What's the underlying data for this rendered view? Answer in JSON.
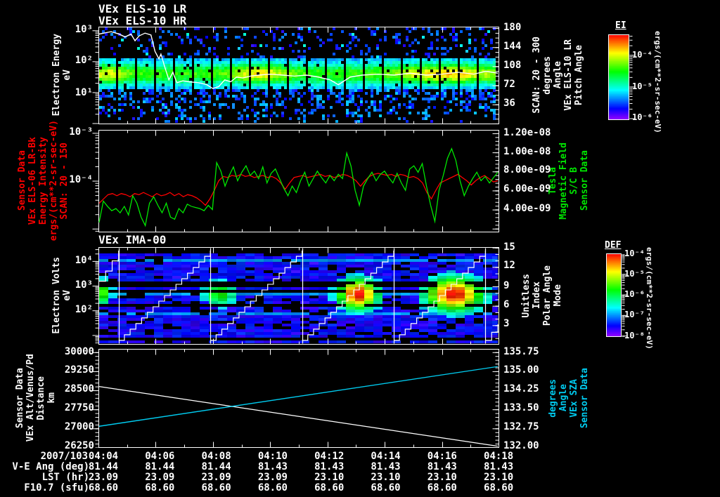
{
  "colors": {
    "background": "#000000",
    "foreground": "#ffffff",
    "red": "#ff0000",
    "green": "#00e600",
    "cyan": "#00ccf0"
  },
  "titles": {
    "els_lr": "VEx ELS-10 LR",
    "els_hr": "VEx ELS-10 HR",
    "ima": "VEx IMA-00"
  },
  "panel1": {
    "ylabel_lines": [
      "Electron Energy",
      "eV"
    ],
    "left_ticks": [
      "10³",
      "10²",
      "10¹"
    ],
    "right_ticks": [
      "180",
      "144",
      "108",
      "72",
      "36"
    ],
    "right_label_lines": [
      "Pitch Angle",
      "VEx ELS-10 LR",
      "Angle",
      "degrees",
      "SCAN: 20 - 300"
    ],
    "colorbar": {
      "title": "EI",
      "ticks": [
        "10⁻⁴",
        "10⁻⁵",
        "10⁻⁶"
      ],
      "unit": "ergs/(cm**2-sr-sec-eV)"
    }
  },
  "panel2": {
    "left_label_lines": [
      "Sensor Data",
      "VEx ELS-06 LR-Bk",
      "Energy Intensity",
      "ergs/(cm**2-sr-sec-eV)",
      "SCAN: 20 - 150"
    ],
    "left_ticks": [
      "10⁻³",
      "10⁻⁴"
    ],
    "right_ticks": [
      "1.20e-08",
      "1.00e-08",
      "8.00e-09",
      "6.00e-09",
      "4.00e-09"
    ],
    "right_label_lines": [
      "Sensor Data",
      "S/C B",
      "Magnetic Field",
      "Tesla"
    ]
  },
  "panel3": {
    "ylabel_lines": [
      "Electron Volts",
      "eV"
    ],
    "left_ticks": [
      "10⁴",
      "10³",
      "10²"
    ],
    "right_ticks": [
      "15",
      "12",
      "9",
      "6",
      "3"
    ],
    "right_label_lines": [
      "Mode",
      "Polar Angle",
      "Index",
      "Unitless"
    ],
    "colorbar": {
      "title": "DEF",
      "ticks": [
        "10⁻⁴",
        "10⁻⁵",
        "10⁻⁶",
        "10⁻⁷",
        "10⁻⁸"
      ],
      "unit": "ergs/(cm**2-sr-sec-eV)"
    }
  },
  "panel4": {
    "left_label_lines": [
      "Sensor Data",
      "VEx Alt/Venus/Pd",
      "Distance",
      "km"
    ],
    "left_ticks": [
      "30000",
      "29250",
      "28500",
      "27750",
      "27000",
      "26250"
    ],
    "right_ticks": [
      "135.75",
      "135.00",
      "134.25",
      "133.50",
      "132.75",
      "132.00"
    ],
    "right_label_lines": [
      "Sensor Data",
      "VEx SZA",
      "Angle",
      "degrees"
    ]
  },
  "timeline": {
    "date": "2007/103",
    "times": [
      "04:04",
      "04:06",
      "04:08",
      "04:10",
      "04:12",
      "04:14",
      "04:16",
      "04:18"
    ]
  },
  "table": {
    "rows": [
      {
        "label": "V-E Ang (deg)",
        "values": [
          "81.44",
          "81.44",
          "81.44",
          "81.43",
          "81.43",
          "81.43",
          "81.43",
          "81.43"
        ]
      },
      {
        "label": "LST (hr)",
        "values": [
          "23.09",
          "23.09",
          "23.09",
          "23.09",
          "23.10",
          "23.10",
          "23.10",
          "23.10"
        ]
      },
      {
        "label": "F10.7 (sfu)",
        "values": [
          "68.60",
          "68.60",
          "68.60",
          "68.60",
          "68.60",
          "68.60",
          "68.60",
          "68.60"
        ]
      }
    ]
  },
  "chart_data": [
    {
      "id": "els_pitch_spectrogram",
      "type": "heatmap",
      "title": "VEx ELS-10 LR / VEx ELS-10 HR",
      "x_start": "04:04",
      "x_end": "04:18",
      "y_scale": "log",
      "y_unit": "eV",
      "y_ticks": [
        1000,
        100,
        10
      ],
      "y2_label": "Pitch Angle (deg)",
      "y2_ticks": [
        180,
        144,
        108,
        72,
        36
      ],
      "colorbar_range": [
        "1e-4",
        "1e-6"
      ],
      "band_center_frac": 0.47,
      "band_sigma": 0.1,
      "base_level": 0.52,
      "segments": 21,
      "hotspots": [
        {
          "x": 0.02,
          "sigma": 0.05,
          "amp": 0.3
        },
        {
          "x": 0.4,
          "sigma": 0.07,
          "amp": 0.33
        },
        {
          "x": 0.86,
          "sigma": 0.12,
          "amp": 0.38
        }
      ],
      "pitch_angle_line": [
        [
          0,
          0.07
        ],
        [
          0.03,
          0.045
        ],
        [
          0.05,
          0.07
        ],
        [
          0.065,
          0.1
        ],
        [
          0.08,
          0.07
        ],
        [
          0.09,
          0.14
        ],
        [
          0.1,
          0.09
        ],
        [
          0.115,
          0.06
        ],
        [
          0.13,
          0.08
        ],
        [
          0.14,
          0.25
        ],
        [
          0.15,
          0.33
        ],
        [
          0.155,
          0.28
        ],
        [
          0.165,
          0.42
        ],
        [
          0.175,
          0.55
        ],
        [
          0.185,
          0.47
        ],
        [
          0.195,
          0.58
        ],
        [
          0.21,
          0.56
        ],
        [
          0.225,
          0.57
        ],
        [
          0.25,
          0.58
        ],
        [
          0.27,
          0.6
        ],
        [
          0.285,
          0.64
        ],
        [
          0.3,
          0.62
        ],
        [
          0.315,
          0.55
        ],
        [
          0.33,
          0.57
        ],
        [
          0.345,
          0.52
        ],
        [
          0.36,
          0.53
        ],
        [
          0.38,
          0.51
        ],
        [
          0.4,
          0.5
        ],
        [
          0.43,
          0.49
        ],
        [
          0.46,
          0.5
        ],
        [
          0.49,
          0.51
        ],
        [
          0.52,
          0.5
        ],
        [
          0.55,
          0.52
        ],
        [
          0.58,
          0.55
        ],
        [
          0.6,
          0.6
        ],
        [
          0.615,
          0.56
        ],
        [
          0.63,
          0.52
        ],
        [
          0.66,
          0.5
        ],
        [
          0.7,
          0.49
        ],
        [
          0.74,
          0.5
        ],
        [
          0.78,
          0.48
        ],
        [
          0.82,
          0.5
        ],
        [
          0.86,
          0.49
        ],
        [
          0.9,
          0.47
        ],
        [
          0.94,
          0.49
        ],
        [
          0.97,
          0.46
        ],
        [
          1.0,
          0.48
        ]
      ]
    },
    {
      "id": "intensity_bfield",
      "type": "line",
      "x_start": "04:04",
      "x_end": "04:18",
      "right_ylim_e9": [
        2.9,
        12.3
      ],
      "series": [
        {
          "name": "VEx ELS-06 LR-Bk energy intensity",
          "color": "#ff0000",
          "y_e9": [
            5.5,
            5.9,
            6.3,
            6.4,
            6.2,
            6.4,
            6.3,
            6.1,
            6.4,
            6.3,
            6.5,
            6.3,
            6.1,
            6.4,
            6.2,
            6.3,
            6.5,
            6.2,
            6.4,
            6.1,
            6.3,
            6.2,
            6.0,
            5.7,
            5.3,
            5.9,
            6.7,
            7.6,
            8.0,
            7.9,
            8.1,
            8.0,
            8.2,
            8.0,
            8.1,
            7.9,
            8.0,
            8.1,
            7.9,
            8.0,
            7.8,
            7.4,
            6.8,
            7.4,
            7.9,
            8.0,
            8.1,
            7.9,
            8.0,
            8.1,
            8.2,
            8.0,
            8.1,
            7.9,
            8.0,
            8.2,
            8.1,
            7.9,
            7.6,
            7.1,
            7.6,
            8.0,
            8.2,
            8.3,
            8.2,
            8.1,
            8.2,
            8.0,
            8.2,
            8.1,
            7.9,
            8.0,
            7.8,
            7.4,
            6.5,
            5.9,
            6.7,
            7.4,
            7.6,
            7.8,
            8.0,
            8.2,
            7.9,
            7.6,
            7.2,
            7.6,
            7.9,
            8.1,
            7.8,
            7.5,
            7.6
          ]
        },
        {
          "name": "S/C B magnetic field",
          "color": "#00e600",
          "y_e9": [
            3.7,
            5.7,
            5.2,
            4.8,
            5.0,
            4.6,
            5.2,
            4.4,
            6.2,
            5.5,
            4.2,
            3.4,
            5.5,
            6.1,
            5.3,
            4.6,
            5.5,
            4.2,
            4.0,
            5.0,
            4.6,
            5.4,
            5.2,
            5.1,
            5.0,
            4.8,
            5.3,
            4.9,
            9.3,
            8.5,
            7.1,
            8.1,
            8.9,
            7.6,
            8.4,
            9.0,
            8.1,
            8.5,
            7.8,
            8.9,
            7.4,
            8.3,
            8.7,
            7.8,
            6.9,
            6.2,
            7.1,
            6.5,
            7.6,
            8.4,
            7.1,
            7.8,
            8.5,
            7.9,
            7.4,
            8.1,
            7.6,
            8.2,
            7.8,
            10.2,
            9.0,
            6.7,
            5.3,
            7.1,
            7.8,
            8.4,
            7.6,
            8.2,
            8.5,
            7.9,
            7.4,
            8.3,
            7.4,
            6.7,
            8.7,
            9.0,
            8.4,
            9.2,
            7.1,
            5.3,
            3.8,
            6.7,
            8.1,
            9.7,
            10.6,
            9.5,
            7.6,
            6.2,
            7.1,
            7.8,
            8.4,
            7.6,
            8.0,
            7.4,
            7.9,
            8.4
          ]
        }
      ]
    },
    {
      "id": "ima_spectrogram",
      "type": "heatmap",
      "title": "VEx IMA-00",
      "y_scale": "log",
      "y_unit": "eV",
      "y_ticks": [
        10000,
        1000,
        100
      ],
      "y2_label": "Polar Angle Index",
      "y2_ticks": [
        15,
        12,
        9,
        6,
        3
      ],
      "colorbar_range": [
        "1e-4",
        "1e-8"
      ],
      "cycle_boundaries": [
        0.049,
        0.279,
        0.509,
        0.739,
        0.969
      ],
      "blobs": [
        {
          "x": 0.015,
          "sx": 0.012,
          "y": 0.45,
          "sy": 0.1,
          "amp": 0.55
        },
        {
          "x": 0.3,
          "sx": 0.03,
          "y": 0.46,
          "sy": 0.1,
          "amp": 0.5
        },
        {
          "x": 0.645,
          "sx": 0.035,
          "y": 0.47,
          "sy": 0.11,
          "amp": 1.0
        },
        {
          "x": 0.885,
          "sx": 0.05,
          "y": 0.47,
          "sy": 0.12,
          "amp": 1.0
        }
      ]
    },
    {
      "id": "alt_sza",
      "type": "line",
      "x_start": "04:04",
      "x_end": "04:18",
      "series": [
        {
          "name": "VEx Alt/Venus/Pd Distance km",
          "color": "#ffffff",
          "axis": "left",
          "ylim": [
            26242,
            30132
          ],
          "x": [
            0,
            1
          ],
          "y": [
            28650,
            26250
          ]
        },
        {
          "name": "VEx SZA Angle degrees",
          "color": "#00ccf0",
          "axis": "right",
          "ylim": [
            131.99,
            135.88
          ],
          "x": [
            0,
            1
          ],
          "y": [
            132.8,
            135.2
          ]
        }
      ]
    }
  ]
}
